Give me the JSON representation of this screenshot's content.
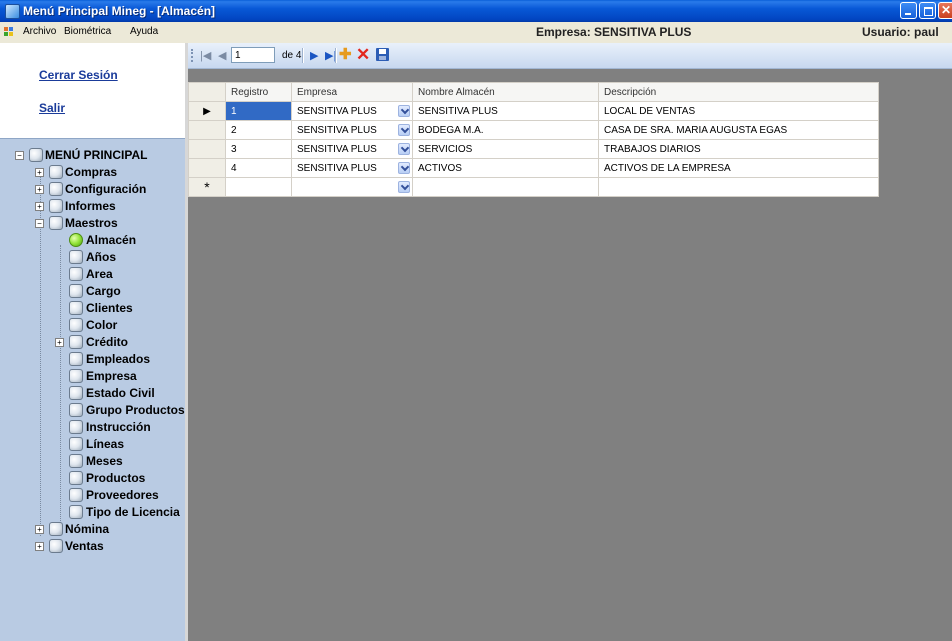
{
  "window": {
    "title": "Menú Principal Mineg - [Almacén]"
  },
  "menubar": {
    "items": [
      "Archivo",
      "Biométrica",
      "Ayuda"
    ],
    "company": "Empresa: SENSITIVA PLUS",
    "user": "Usuario: paul"
  },
  "sidebar": {
    "logout": "Cerrar Sesión",
    "exit": "Salir",
    "root": "MENÚ PRINCIPAL",
    "groups": [
      "Compras",
      "Configuración",
      "Informes",
      "Maestros"
    ],
    "maestros": [
      "Almacén",
      "Años",
      "Area",
      "Cargo",
      "Clientes",
      "Color",
      "Crédito",
      "Empleados",
      "Empresa",
      "Estado Civil",
      "Grupo Productos",
      "Instrucción",
      "Líneas",
      "Meses",
      "Productos",
      "Proveedores",
      "Tipo de Licencia"
    ],
    "bottom_groups": [
      "Nómina",
      "Ventas"
    ]
  },
  "navigator": {
    "position": "1",
    "count_label": "de 4"
  },
  "grid": {
    "columns": [
      "Registro",
      "Empresa",
      "Nombre Almacén",
      "Descripción"
    ],
    "rows": [
      [
        "1",
        "SENSITIVA PLUS",
        "SENSITIVA PLUS",
        "LOCAL DE VENTAS"
      ],
      [
        "2",
        "SENSITIVA PLUS",
        "BODEGA M.A.",
        "CASA DE SRA. MARIA AUGUSTA EGAS"
      ],
      [
        "3",
        "SENSITIVA PLUS",
        "SERVICIOS",
        "TRABAJOS DIARIOS"
      ],
      [
        "4",
        "SENSITIVA PLUS",
        "ACTIVOS",
        "ACTIVOS DE LA EMPRESA"
      ]
    ],
    "new_row_marker": "*"
  }
}
